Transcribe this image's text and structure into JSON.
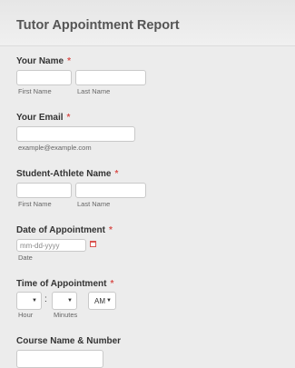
{
  "form": {
    "title": "Tutor Appointment Report",
    "required_mark": "*",
    "your_name": {
      "label": "Your Name",
      "first_sub": "First Name",
      "last_sub": "Last Name"
    },
    "your_email": {
      "label": "Your Email",
      "sub": "example@example.com"
    },
    "athlete_name": {
      "label": "Student-Athlete Name",
      "first_sub": "First Name",
      "last_sub": "Last Name"
    },
    "date": {
      "label": "Date of Appointment",
      "placeholder": "mm-dd-yyyy",
      "sub": "Date",
      "icon": "calendar-icon"
    },
    "time": {
      "label": "Time of Appointment",
      "separator": ":",
      "hour_sub": "Hour",
      "minutes_sub": "Minutes",
      "ampm_value": "AM",
      "caret": "▼"
    },
    "course": {
      "label": "Course Name & Number"
    }
  }
}
